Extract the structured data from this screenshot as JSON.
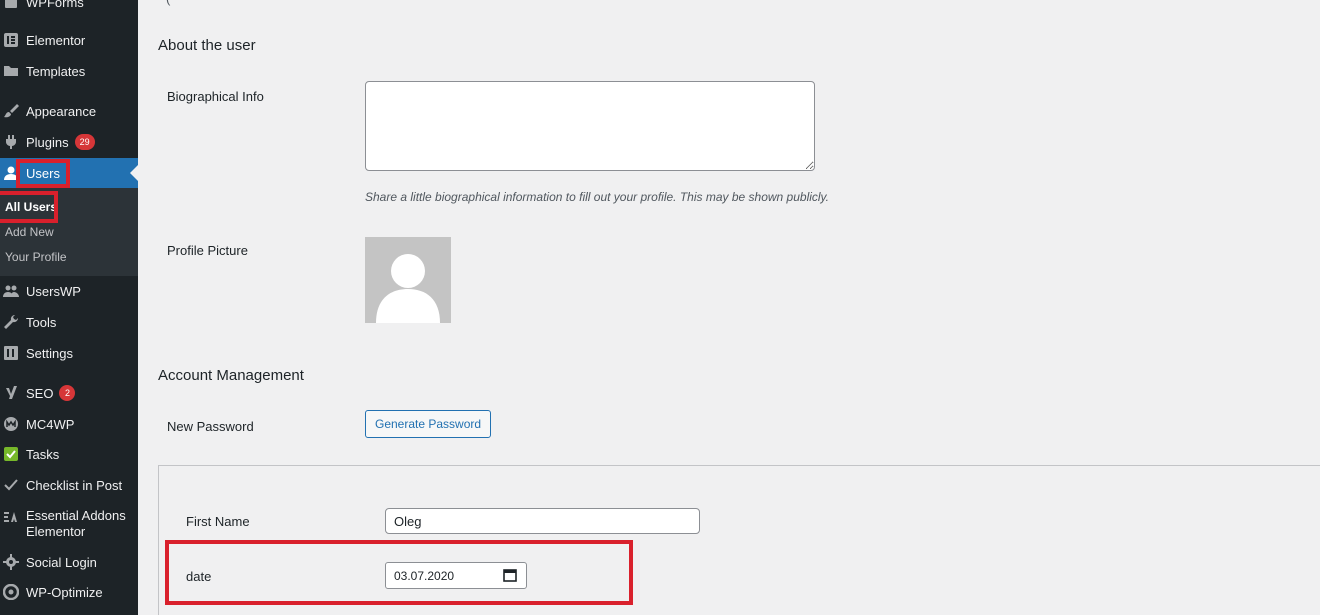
{
  "sidebar": {
    "items": [
      {
        "label": "WPForms",
        "icon": "wpforms-icon"
      },
      {
        "label": "Elementor",
        "icon": "elementor-icon"
      },
      {
        "label": "Templates",
        "icon": "folder-icon"
      },
      {
        "label": "Appearance",
        "icon": "paintbrush-icon"
      },
      {
        "label": "Plugins",
        "icon": "plugin-icon",
        "badge": "29"
      },
      {
        "label": "Users",
        "icon": "user-icon"
      },
      {
        "label": "UsersWP",
        "icon": "userswp-icon"
      },
      {
        "label": "Tools",
        "icon": "wrench-icon"
      },
      {
        "label": "Settings",
        "icon": "settings-icon"
      },
      {
        "label": "SEO",
        "icon": "yoast-icon",
        "badge": "2"
      },
      {
        "label": "MC4WP",
        "icon": "mc4wp-icon"
      },
      {
        "label": "Tasks",
        "icon": "checkbox-icon"
      },
      {
        "label": "Checklist in Post",
        "icon": "checkmark-icon"
      },
      {
        "label": "Essential Addons Elementor",
        "icon": "essential-addons-icon"
      },
      {
        "label": "Social Login",
        "icon": "gear-icon"
      },
      {
        "label": "WP-Optimize",
        "icon": "wp-optimize-icon"
      }
    ],
    "submenu": [
      {
        "label": "All Users"
      },
      {
        "label": "Add New"
      },
      {
        "label": "Your Profile"
      }
    ]
  },
  "main": {
    "top_fragment": "(",
    "about_title": "About the user",
    "bio_label": "Biographical Info",
    "bio_value": "",
    "bio_description": "Share a little biographical information to fill out your profile. This may be shown publicly.",
    "profile_picture_label": "Profile Picture",
    "account_title": "Account Management",
    "new_password_label": "New Password",
    "generate_password_button": "Generate Password",
    "first_name_label": "First Name",
    "first_name_value": "Oleg",
    "date_label": "date",
    "date_value": "03.07.2020"
  },
  "colors": {
    "sidebar_bg": "#1d2327",
    "active_blue": "#2271b1",
    "highlight_red": "#d9202c",
    "badge_red": "#d63638"
  }
}
